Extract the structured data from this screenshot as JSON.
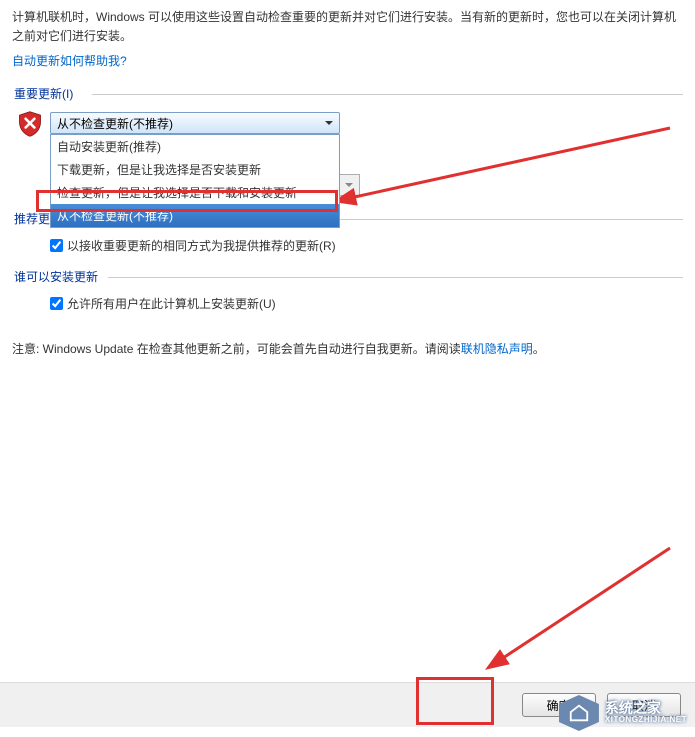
{
  "intro": {
    "line1": "计算机联机时，Windows 可以使用这些设置自动检查重要的更新并对它们进行安装。当有新的更新时，您也可以在关闭计算机之前对它们进行安装。",
    "help_link": "自动更新如何帮助我?"
  },
  "important_updates": {
    "header": "重要更新(I)",
    "selected": "从不检查更新(不推荐)",
    "options": [
      "自动安装更新(推荐)",
      "下载更新，但是让我选择是否安装更新",
      "检查更新，但是让我选择是否下载和安装更新",
      "从不检查更新(不推荐)"
    ]
  },
  "recommended_updates": {
    "header": "推荐更新",
    "checkbox_label": "以接收重要更新的相同方式为我提供推荐的更新(R)"
  },
  "who_can_install": {
    "header": "谁可以安装更新",
    "checkbox_label": "允许所有用户在此计算机上安装更新(U)"
  },
  "note": {
    "prefix": "注意: Windows Update 在检查其他更新之前，可能会首先自动进行自我更新。请阅读",
    "link": "联机隐私声明",
    "suffix": "。"
  },
  "buttons": {
    "ok": "确定",
    "cancel": "取消"
  },
  "watermark": {
    "title": "系统之家",
    "sub": "XITONGZHIJIA.NET"
  }
}
